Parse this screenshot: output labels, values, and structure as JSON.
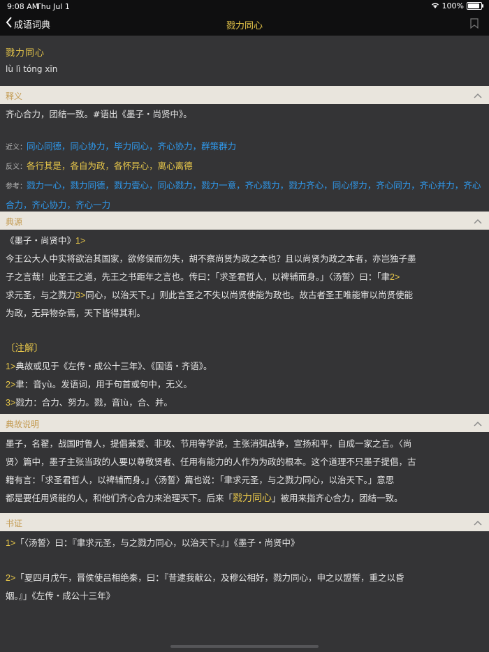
{
  "status": {
    "time": "9:08 AM",
    "date": "Thu Jul 1",
    "battery": "100%",
    "battery_level": 1.0
  },
  "nav": {
    "back_label": "成语词典",
    "title": "戮力同心"
  },
  "entry": {
    "word": "戮力同心",
    "pinyin": "lù lì tóng xīn"
  },
  "sections": {
    "shiyi": "释义",
    "dianyuan": "典源",
    "diangu": "典故说明",
    "shuzheng": "书证"
  },
  "definition": "齐心合力，团结一致。#语出《墨子・尚贤中》。",
  "related": {
    "synonym_label": "近义",
    "antonym_label": "反义",
    "reference_label": "参考",
    "sep": "，",
    "synonyms": [
      "同心同德",
      "同心协力",
      "毕力同心",
      "齐心协力",
      "群策群力"
    ],
    "antonyms": [
      "各行其是",
      "各自为政",
      "各怀异心",
      "离心离德"
    ],
    "references": [
      "戮力一心",
      "戮力同德",
      "戮力壹心",
      "同心戮力",
      "戮力一意",
      "齐心戮力",
      "戮力齐心",
      "同心僇力",
      "齐心同力",
      "齐心并力",
      "齐心合力",
      "齐心协力",
      "齐心一力"
    ]
  },
  "source": {
    "title_a": "《墨子・尚贤中》",
    "m1": "1>",
    "line1": "今王公大人中实将欲治其国家，欲修保而勿失，胡不察尚贤为政之本也？且以尚贤为政之本者，亦岂独子墨",
    "line2": "子之言哉！此圣王之道，先王之书距年之言也。传曰：「求圣君哲人，以裨辅而身。」〈汤誓〉曰：「聿",
    "m2": "2>",
    "line3a": "求元圣，与之戮力",
    "m3": "3>",
    "line3b": "同心，以治天下。」则此言圣之不失以尚贤使能为政也。故古者圣王唯能审以尚贤使能",
    "line4": "为政，无异物杂焉，天下皆得其利。",
    "notes_heading": "〔注解〕",
    "notes": [
      {
        "mark": "1>",
        "text": "典故或见于《左传・成公十三年》、《国语・齐语》。"
      },
      {
        "mark": "2>",
        "text": "聿：音yù。发语词，用于句首或句中，无义。"
      },
      {
        "mark": "3>",
        "text": "戮力：合力、努力。戮，音lù，合、并。"
      }
    ]
  },
  "story": {
    "line1": "墨子，名翟，战国时鲁人，提倡兼爱、非攻、节用等学说，主张消弭战争，宣扬和平，自成一家之言。〈尚",
    "line2": "贤〉篇中，墨子主张当政的人要以尊敬贤者、任用有能力的人作为为政的根本。这个道理不只墨子提倡，古",
    "line3": "籍有言：「求圣君哲人，以裨辅而身。」〈汤誓〉篇也说：「聿求元圣，与之戮力同心，以治天下。」意思",
    "line4a": "都是要任用贤能的人，和他们齐心合力来治理天下。后来「",
    "line4hl": "戮力同心",
    "line4b": "」被用来指齐心合力，团结一致。"
  },
  "evidence": [
    {
      "mark": "1>",
      "text": "「〈汤誓〉曰：『聿求元圣，与之戮力同心，以治天下。』」《墨子・尚贤中》"
    },
    {
      "mark": "2>",
      "text": "「夏四月戊午，晋侯使吕相绝秦，曰：『昔逮我献公，及穆公相好，戮力同心，申之以盟誓，重之以昏",
      "text2": "姻。』」《左传・成公十三年》"
    }
  ]
}
